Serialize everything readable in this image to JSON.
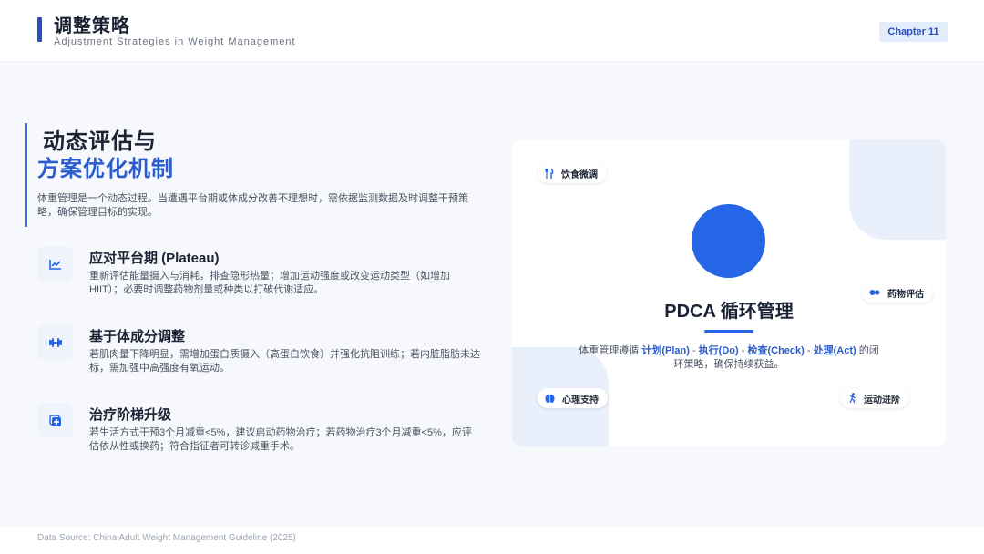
{
  "header": {
    "title": "调整策略",
    "subtitle": "Adjustment Strategies in Weight Management",
    "chapter": "Chapter 11"
  },
  "intro": {
    "title_line1": "动态评估与",
    "title_line2": "方案优化机制",
    "description": "体重管理是一个动态过程。当遭遇平台期或体成分改善不理想时，需依据监测数据及时调整干预策略，确保管理目标的实现。"
  },
  "items": [
    {
      "title": "应对平台期 (Plateau)",
      "description": "重新评估能量摄入与消耗，排查隐形热量；增加运动强度或改变运动类型（如增加HIIT）；必要时调整药物剂量或种类以打破代谢适应。",
      "icon": "trend-chart-icon"
    },
    {
      "title": "基于体成分调整",
      "description": "若肌肉量下降明显，需增加蛋白质摄入（高蛋白饮食）并强化抗阻训练；若内脏脂肪未达标，需加强中高强度有氧运动。",
      "icon": "dumbbell-icon"
    },
    {
      "title": "治疗阶梯升级",
      "description": "若生活方式干预3个月减重<5%，建议启动药物治疗；若药物治疗3个月减重<5%，应评估依从性或换药；符合指征者可转诊减重手术。",
      "icon": "medical-plus-icon"
    }
  ],
  "card": {
    "title": "PDCA 循环管理",
    "desc_prefix": "体重管理遵循 ",
    "plan": "计划(Plan)",
    "sep": " - ",
    "do": "执行(Do)",
    "check": "检查(Check)",
    "act": "处理(Act)",
    "desc_suffix": " 的闭环策略，确保持续获益。",
    "tags": {
      "diet": "饮食微调",
      "medication": "药物评估",
      "psychology": "心理支持",
      "exercise": "运动进阶"
    }
  },
  "footer": {
    "source": "Data Source: China Adult Weight Management Guideline (2025)"
  },
  "colors": {
    "accent": "#2566e6",
    "brand_dark": "#2a4fb8",
    "light_blue": "#e9f0fc"
  }
}
